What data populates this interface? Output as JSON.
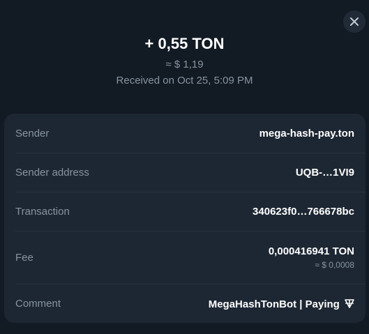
{
  "header": {
    "amount": "+ 0,55 TON",
    "fiat_value": "≈ $ 1,19",
    "received_date": "Received on Oct 25, 5:09 PM"
  },
  "details": {
    "sender_label": "Sender",
    "sender_value": "mega-hash-pay.ton",
    "sender_address_label": "Sender address",
    "sender_address_value": "UQB-…1VI9",
    "transaction_label": "Transaction",
    "transaction_value": "340623f0…766678bc",
    "fee_label": "Fee",
    "fee_value": "0,000416941 TON",
    "fee_fiat": "≈ $ 0,0008",
    "comment_label": "Comment",
    "comment_value": "MegaHashTonBot | Paying"
  },
  "icons": {
    "close": "close-icon",
    "comment_glyph": "ton-currency-icon"
  },
  "colors": {
    "background": "#121a23",
    "card": "#1d2733",
    "muted_text": "#8794a1",
    "primary_text": "#ffffff"
  }
}
